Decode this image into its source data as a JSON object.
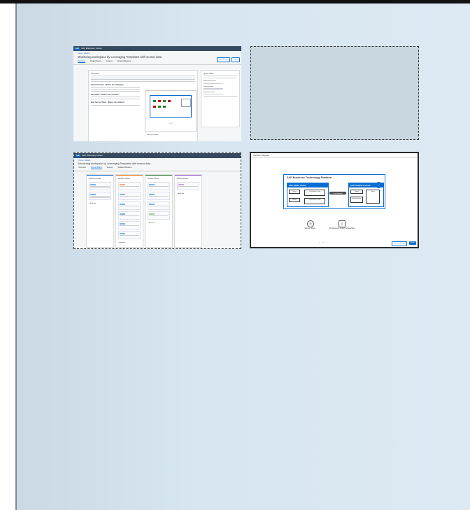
{
  "app": {
    "shell_title": "SAP Discovery Center",
    "logo_text": "SAP",
    "brand_color": "#0a6ed1",
    "shell_color": "#354a5f"
  },
  "tile_overview": {
    "breadcrumb": "Home  /  Mission",
    "page_title": "Monitoring workspace by Leveraging Templates with sensor data",
    "button_start": "Start Mission",
    "button_share": "Share",
    "tabs": [
      "Overview",
      "Project Board",
      "Support",
      "Related Missions"
    ],
    "panel_overview": "Overview",
    "subheads": [
      "Current Position - What is the challenge?",
      "Destination - What is the outcome?",
      "How You Get There - What is the solution?"
    ],
    "panel_side": "Quick Stats",
    "side_items": [
      "Required Services",
      "Estimated time",
      "Experience level"
    ],
    "diagram_caption": "Solution Diagram"
  },
  "tile_board": {
    "breadcrumb": "Home  /  Mission",
    "page_title": "Monitoring workspace by Leveraging Templates with sensor data",
    "tabs": [
      "Overview",
      "Project Board",
      "Support",
      "Related Missions"
    ],
    "columns": [
      {
        "name": "Discover Phase",
        "color": "#0a6ed1"
      },
      {
        "name": "Prepare Phase",
        "color": "#e9730c"
      },
      {
        "name": "Explore Phase",
        "color": "#2b7d2b"
      },
      {
        "name": "Realize Phase",
        "color": "#925ace"
      }
    ],
    "add_task": "+ Add task"
  },
  "tile_diagram": {
    "dialog_title": "Solution Diagram",
    "platform": "SAP Business Technology Platform",
    "hana": "SAP HANA Cloud",
    "sac": "SAP Analytics Cloud",
    "hana_boxes": [
      "Views",
      "Calculation View",
      "Tables",
      "Calculation View"
    ],
    "sac_boxes": [
      "Model",
      "Story",
      "Data Analyzer"
    ],
    "connector": "Live Connection",
    "sources": [
      "Sensor Data",
      "Flowsheets (CSV) Shapefiles"
    ],
    "page": "1",
    "btn_open": "Open in new tab",
    "btn_close": "Close"
  }
}
